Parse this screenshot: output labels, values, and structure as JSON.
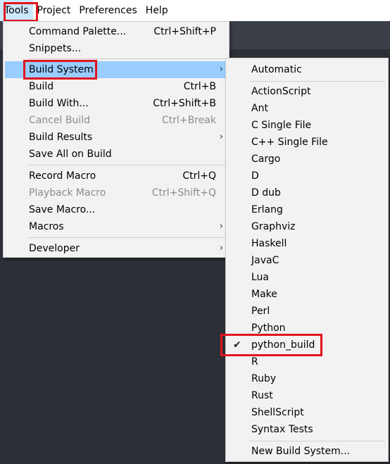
{
  "menubar": {
    "items": [
      "Tools",
      "Project",
      "Preferences",
      "Help"
    ]
  },
  "tools_menu": {
    "items": [
      {
        "label": "Command Palette...",
        "shortcut": "Ctrl+Shift+P"
      },
      {
        "label": "Snippets...",
        "shortcut": ""
      },
      {
        "label": "Build System",
        "shortcut": "",
        "submenu": true
      },
      {
        "label": "Build",
        "shortcut": "Ctrl+B"
      },
      {
        "label": "Build With...",
        "shortcut": "Ctrl+Shift+B"
      },
      {
        "label": "Cancel Build",
        "shortcut": "Ctrl+Break",
        "disabled": true
      },
      {
        "label": "Build Results",
        "shortcut": "",
        "submenu": true
      },
      {
        "label": "Save All on Build",
        "shortcut": ""
      },
      {
        "label": "Record Macro",
        "shortcut": "Ctrl+Q"
      },
      {
        "label": "Playback Macro",
        "shortcut": "Ctrl+Shift+Q",
        "disabled": true
      },
      {
        "label": "Save Macro...",
        "shortcut": ""
      },
      {
        "label": "Macros",
        "shortcut": "",
        "submenu": true
      },
      {
        "label": "Developer",
        "shortcut": "",
        "submenu": true
      }
    ]
  },
  "build_system_menu": {
    "items": [
      "Automatic",
      "ActionScript",
      "Ant",
      "C Single File",
      "C++ Single File",
      "Cargo",
      "D",
      "D dub",
      "Erlang",
      "Graphviz",
      "Haskell",
      "JavaC",
      "Lua",
      "Make",
      "Perl",
      "Python",
      "python_build",
      "R",
      "Ruby",
      "Rust",
      "ShellScript",
      "Syntax Tests",
      "New Build System..."
    ],
    "checked": "python_build",
    "check_glyph": "✔",
    "arrow_glyph": "›"
  },
  "colors": {
    "highlight": "#99ccff",
    "menubar_active": "#cce8ff",
    "annotation": "#e1141e",
    "background": "#2b2f36"
  }
}
